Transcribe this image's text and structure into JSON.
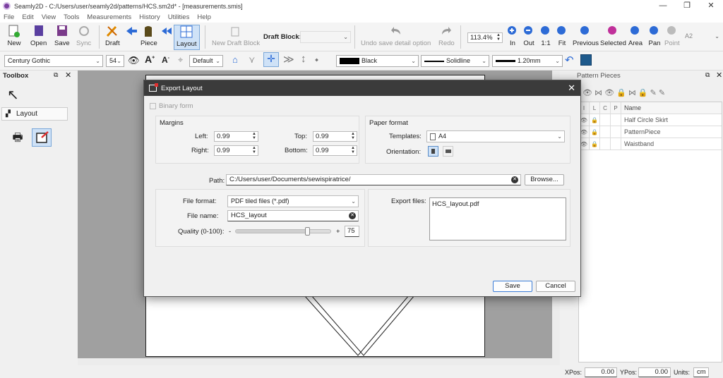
{
  "window": {
    "title": "Seamly2D - C:/Users/user/seamly2d/patterns/HCS.sm2d* - [measurements.smis]"
  },
  "menu": [
    "File",
    "Edit",
    "View",
    "Tools",
    "Measurements",
    "History",
    "Utilities",
    "Help"
  ],
  "toolbar": {
    "new": "New",
    "open": "Open",
    "save": "Save",
    "sync": "Sync",
    "draft": "Draft",
    "piece": "Piece",
    "layout": "Layout",
    "new_draft_block": "New Draft Block",
    "draft_block_label": "Draft Block:",
    "undo_detail": "Undo save detail option",
    "redo": "Redo",
    "zoom": "113.4%",
    "zoom_in": "In",
    "zoom_out": "Out",
    "zoom_1to1": "1:1",
    "zoom_fit": "Fit",
    "previous": "Previous",
    "selected": "Selected",
    "area": "Area",
    "pan": "Pan",
    "point": "Point",
    "paper_size": "A2"
  },
  "toolbar2": {
    "font": "Century Gothic",
    "font_size": "54",
    "label_default": "Default",
    "color": "Black",
    "line_type": "Solidline",
    "line_weight": "1.20mm"
  },
  "toolbox": {
    "title": "Toolbox",
    "layout": "Layout"
  },
  "pattern_pieces": {
    "title": "Pattern Pieces",
    "headers": [
      "I",
      "L",
      "C",
      "P",
      "Name"
    ],
    "items": [
      "Half Circle Skirt",
      "PatternPiece",
      "Waistband"
    ]
  },
  "dialog": {
    "title": "Export Layout",
    "binary_form": "Binary form",
    "margins": {
      "title": "Margins",
      "left_label": "Left:",
      "left": "0.99",
      "top_label": "Top:",
      "top": "0.99",
      "right_label": "Right:",
      "right": "0.99",
      "bottom_label": "Bottom:",
      "bottom": "0.99"
    },
    "paper": {
      "title": "Paper format",
      "templates_label": "Templates:",
      "template": "A4",
      "orientation_label": "Orientation:"
    },
    "path_label": "Path:",
    "path": "C:/Users/user/Documents/sewispiratrice/",
    "browse": "Browse...",
    "file_format_label": "File format:",
    "file_format": "PDF tiled files (*.pdf)",
    "file_name_label": "File name:",
    "file_name": "HCS_layout",
    "quality_label": "Quality (0-100):",
    "quality_minus": "-",
    "quality_plus": "+",
    "quality": "75",
    "export_files_label": "Export files:",
    "export_file": "HCS_layout.pdf",
    "save": "Save",
    "cancel": "Cancel"
  },
  "status": {
    "xpos_label": "XPos:",
    "xpos": "0.00",
    "ypos_label": "YPos:",
    "ypos": "0.00",
    "units_label": "Units:",
    "units": "cm"
  }
}
